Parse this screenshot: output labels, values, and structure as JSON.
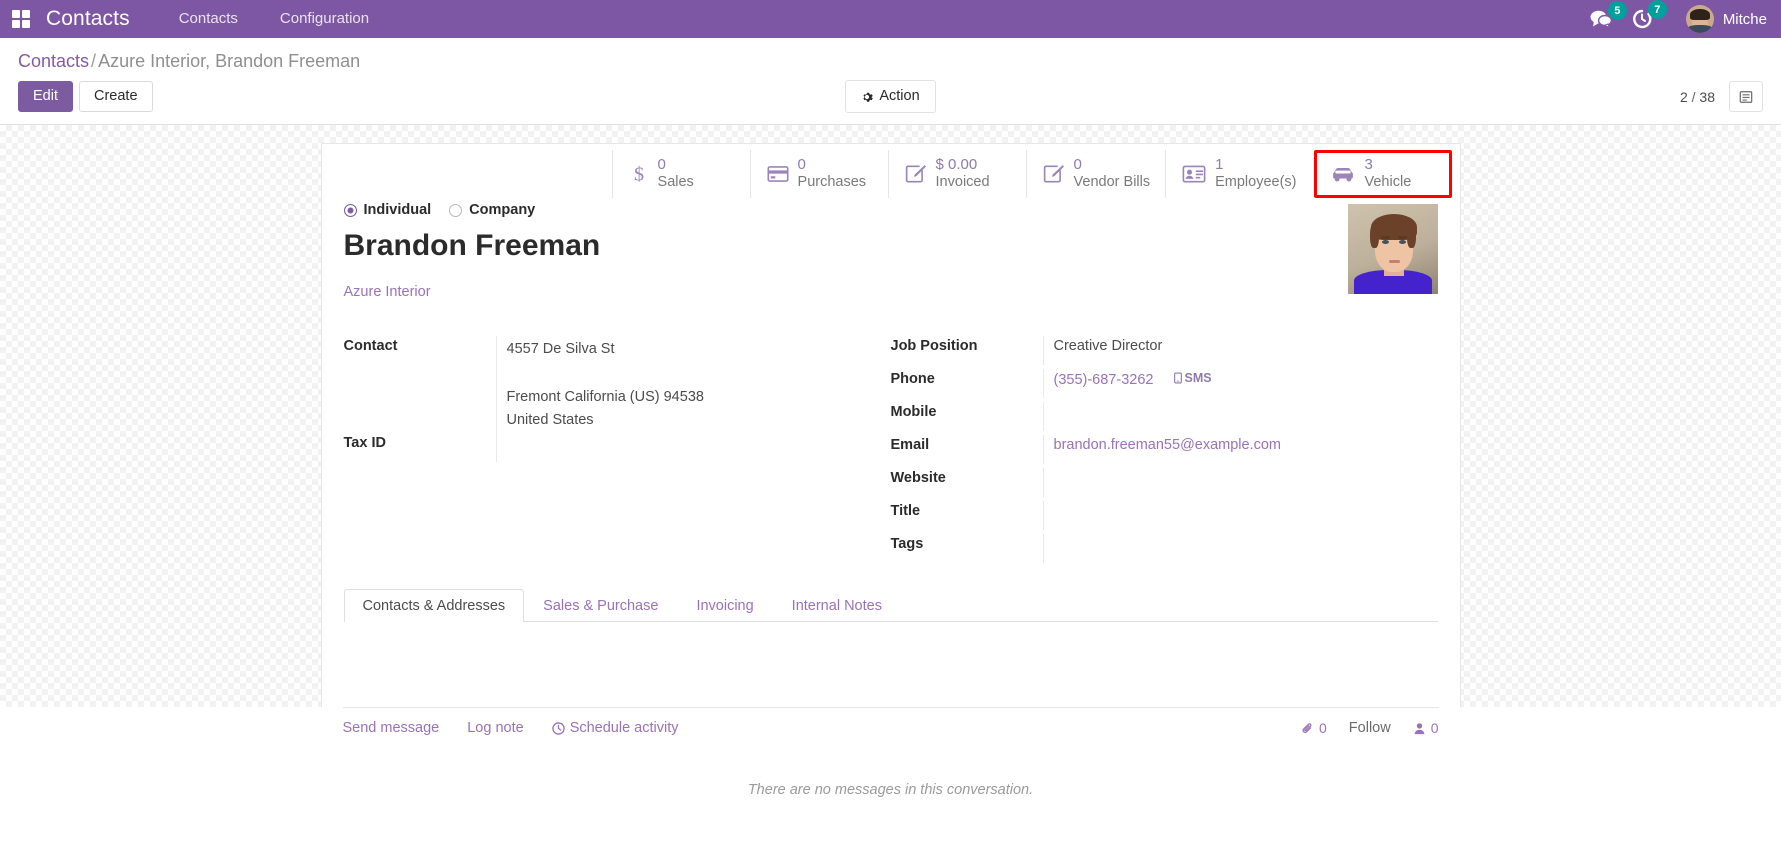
{
  "navbar": {
    "apps_icon": "apps-grid-icon",
    "brand": "Contacts",
    "menu": [
      {
        "label": "Contacts"
      },
      {
        "label": "Configuration"
      }
    ],
    "messages_icon": "messages-icon",
    "messages_count": "5",
    "activities_icon": "activity-clock-icon",
    "activities_count": "7",
    "user_name": "Mitche",
    "accent_color": "#7e57a4",
    "badge_color": "#00a09d"
  },
  "control_panel": {
    "breadcrumb_root": "Contacts",
    "breadcrumb_sep": "/",
    "breadcrumb_current": "Azure Interior, Brandon Freeman",
    "edit_label": "Edit",
    "create_label": "Create",
    "action_label": "Action",
    "action_icon": "gear-icon",
    "pager_current": "2",
    "pager_sep": "/",
    "pager_total": "38",
    "view_switch_icon": "form-view-icon"
  },
  "stat_buttons": [
    {
      "icon": "dollar-sign-icon",
      "value": "0",
      "label": "Sales",
      "highlighted": false
    },
    {
      "icon": "credit-card-icon",
      "value": "0",
      "label": "Purchases",
      "highlighted": false
    },
    {
      "icon": "pencil-square-icon",
      "value": "$ 0.00",
      "label": "Invoiced",
      "highlighted": false
    },
    {
      "icon": "pencil-square-icon",
      "value": "0",
      "label": "Vendor Bills",
      "highlighted": false
    },
    {
      "icon": "id-card-icon",
      "value": "1",
      "label": "Employee(s)",
      "highlighted": false
    },
    {
      "icon": "car-icon",
      "value": "3",
      "label": "Vehicle",
      "highlighted": true
    }
  ],
  "highlight_color": "#ff0000",
  "form": {
    "company_type": {
      "selected": "individual",
      "options": [
        {
          "key": "individual",
          "label": "Individual"
        },
        {
          "key": "company",
          "label": "Company"
        }
      ]
    },
    "name": "Brandon Freeman",
    "parent_company": "Azure Interior",
    "avatar": "contact-photo",
    "left_fields": [
      {
        "label": "Contact",
        "value": ""
      },
      {
        "label": "Tax ID",
        "value": ""
      }
    ],
    "address": {
      "street": "4557 De Silva St",
      "street2": "",
      "city_state_zip": "Fremont  California (US)  94538",
      "country": "United States"
    },
    "right_fields": [
      {
        "label": "Job Position",
        "value": "Creative Director",
        "kind": "text"
      },
      {
        "label": "Phone",
        "value": "(355)-687-3262",
        "kind": "link",
        "suffix": "SMS",
        "suffix_icon": "mobile-icon"
      },
      {
        "label": "Mobile",
        "value": "",
        "kind": "text"
      },
      {
        "label": "Email",
        "value": "brandon.freeman55@example.com",
        "kind": "link"
      },
      {
        "label": "Website",
        "value": "",
        "kind": "text"
      },
      {
        "label": "Title",
        "value": "",
        "kind": "text"
      },
      {
        "label": "Tags",
        "value": "",
        "kind": "text"
      }
    ]
  },
  "notebook": {
    "tabs": [
      {
        "label": "Contacts & Addresses",
        "active": true
      },
      {
        "label": "Sales & Purchase",
        "active": false
      },
      {
        "label": "Invoicing",
        "active": false
      },
      {
        "label": "Internal Notes",
        "active": false
      }
    ]
  },
  "chatter": {
    "send_message": "Send message",
    "log_note": "Log note",
    "schedule_activity": "Schedule activity",
    "schedule_icon": "clock-icon",
    "attachment_icon": "paperclip-icon",
    "attachment_count": "0",
    "follow_label": "Follow",
    "followers_icon": "user-icon",
    "followers_count": "0",
    "empty_text": "There are no messages in this conversation."
  }
}
